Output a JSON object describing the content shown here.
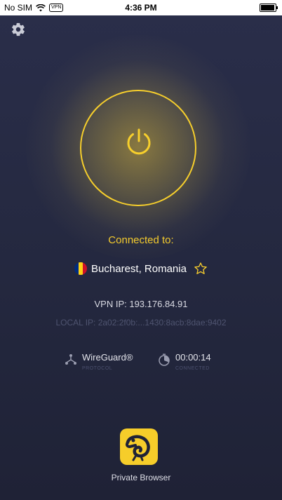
{
  "status_bar": {
    "carrier": "No SIM",
    "vpn_badge": "VPN",
    "time": "4:36 PM",
    "battery_level": 0.95
  },
  "settings": {
    "icon": "gear-icon"
  },
  "power": {
    "icon": "power-icon",
    "color": "#f7cf2c"
  },
  "connection": {
    "label": "Connected to:",
    "location": "Bucharest, Romania",
    "flag": "romania-flag-icon",
    "favorite_icon": "star-icon"
  },
  "network": {
    "vpn_ip": "VPN IP: 193.176.84.91",
    "local_ip": "LOCAL IP: 2a02:2f0b:...1430:8acb:8dae:9402"
  },
  "stats": {
    "protocol": {
      "value": "WireGuard®",
      "caption": "PROTOCOL",
      "icon": "protocol-icon"
    },
    "duration": {
      "value": "00:00:14",
      "caption": "CONNECTED",
      "icon": "timer-icon"
    }
  },
  "private_browser": {
    "label": "Private Browser",
    "icon": "chameleon-icon"
  },
  "colors": {
    "accent": "#f4cb2e",
    "background": "#262a43"
  }
}
